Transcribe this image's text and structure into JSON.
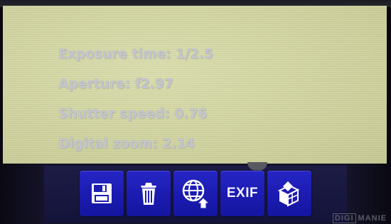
{
  "exif_info": {
    "lines": [
      "Exposure time: 1/2.5",
      "Aperture: f2.97",
      "Shutter speed: 0.76",
      "Digital zoom: 2.14"
    ]
  },
  "toolbar": {
    "buttons": [
      {
        "icon": "save-disk-icon"
      },
      {
        "icon": "trash-icon"
      },
      {
        "icon": "globe-upload-icon"
      },
      {
        "icon": "exif-icon",
        "label": "EXIF"
      },
      {
        "icon": "crop-tool-icon"
      }
    ]
  },
  "watermark": {
    "part1": "DIGI",
    "part2": "MANIE"
  },
  "colors": {
    "screen_background": "#d3d6a4",
    "exif_text": "#c3c5ce",
    "button_blue": "#1f1fba",
    "toolbar_background": "#1a1940"
  }
}
